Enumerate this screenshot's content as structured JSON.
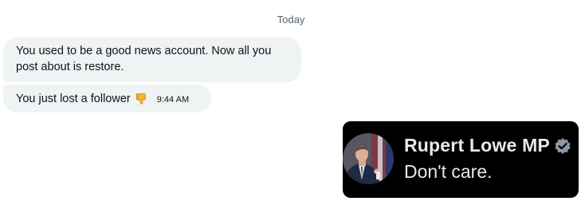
{
  "conversation": {
    "date_divider": "Today",
    "messages": [
      {
        "text": "You used to be a good news account. Now all you post about is restore."
      },
      {
        "text": "You just lost a follower",
        "emoji_icon": "thumbs-down-icon",
        "time": "9:44 AM"
      }
    ]
  },
  "reply_card": {
    "author": "Rupert Lowe MP",
    "badge_icon": "verified-badge-icon",
    "text": "Don't care."
  },
  "colors": {
    "incoming_bubble": "#eff3f4",
    "date_text": "#536471",
    "card_background": "#000000",
    "card_text": "#e7e9ea",
    "badge": "#8b98a5"
  }
}
